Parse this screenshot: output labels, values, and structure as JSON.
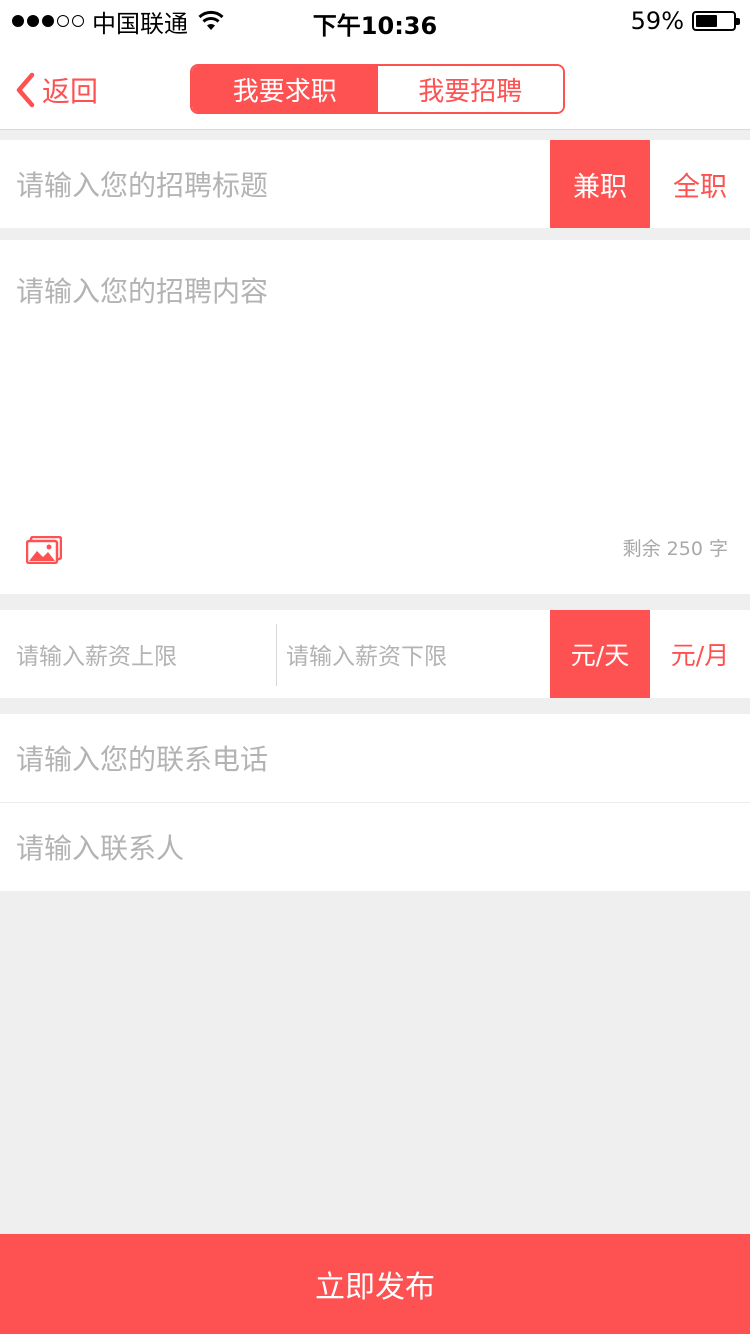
{
  "status_bar": {
    "carrier": "中国联通",
    "time": "下午10:36",
    "battery_percent": "59%",
    "battery_level": 0.59,
    "signal_bars_filled": 3,
    "signal_bars_total": 5
  },
  "nav": {
    "back_label": "返回",
    "segments": [
      "我要求职",
      "我要招聘"
    ],
    "active_segment": "我要求职"
  },
  "title_row": {
    "placeholder": "请输入您的招聘标题",
    "type_options": [
      "兼职",
      "全职"
    ],
    "selected_type": "兼职"
  },
  "content": {
    "placeholder": "请输入您的招聘内容",
    "remaining_text": "剩余 250 字",
    "image_icon": "image-gallery-icon"
  },
  "salary": {
    "max_placeholder": "请输入薪资上限",
    "min_placeholder": "请输入薪资下限",
    "unit_options": [
      "元/天",
      "元/月"
    ],
    "selected_unit": "元/天"
  },
  "contact": {
    "phone_placeholder": "请输入您的联系电话",
    "person_placeholder": "请输入联系人"
  },
  "publish_label": "立即发布",
  "colors": {
    "accent": "#fe5252",
    "background": "#efefef",
    "placeholder": "#b3b3b3"
  }
}
